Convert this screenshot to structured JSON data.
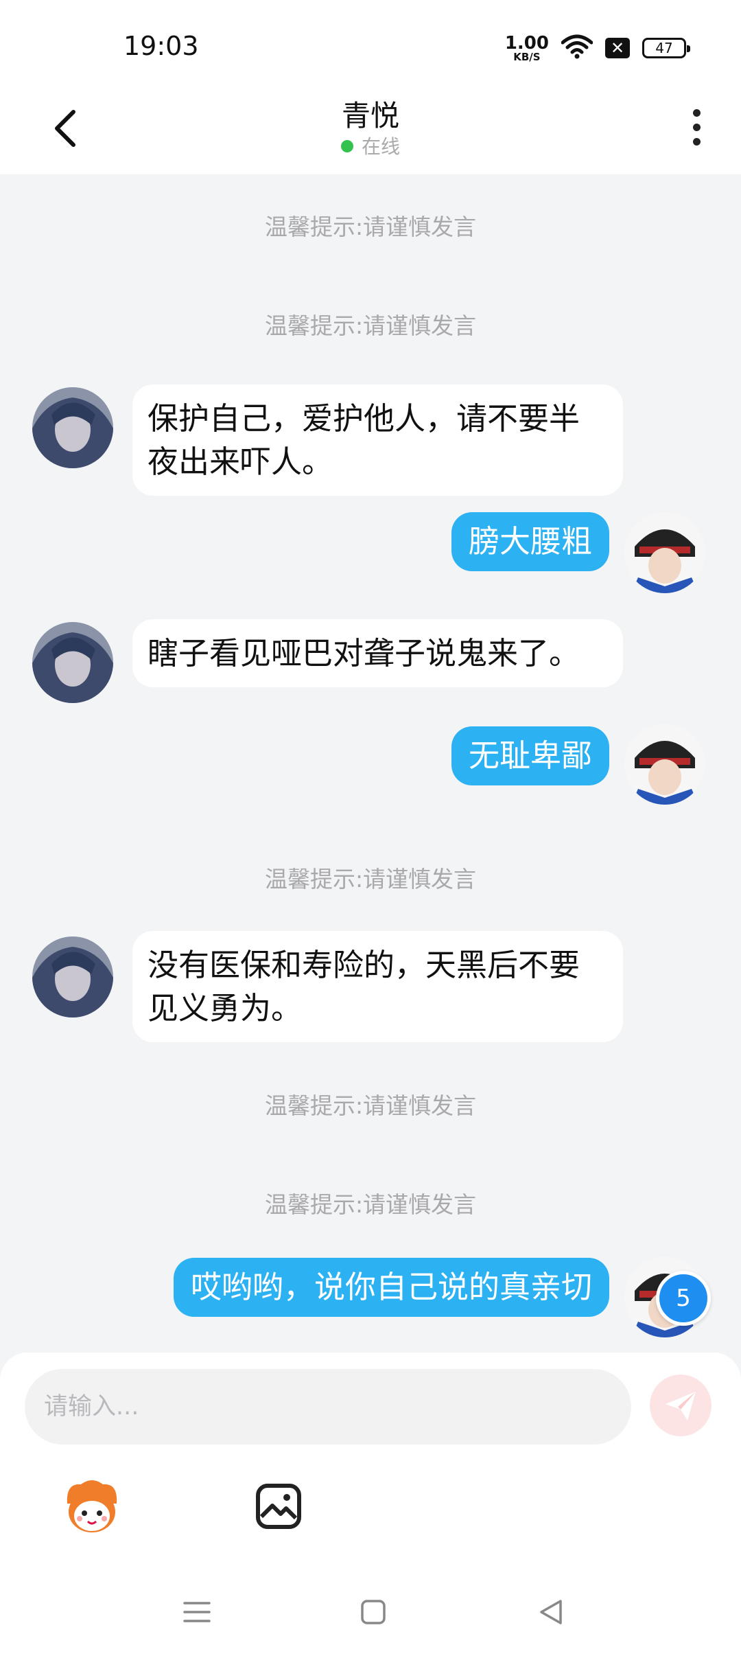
{
  "status_bar": {
    "time": "19:03",
    "net_speed_value": "1.00",
    "net_speed_unit": "KB/S",
    "battery": "47",
    "icons": [
      "wifi-icon",
      "close-badge-icon",
      "battery-icon"
    ]
  },
  "header": {
    "title": "青悦",
    "status": "在线",
    "status_color": "#33c24d"
  },
  "chat": {
    "hints": [
      "温馨提示:请谨慎发言",
      "温馨提示:请谨慎发言",
      "温馨提示:请谨慎发言",
      "温馨提示:请谨慎发言",
      "温馨提示:请谨慎发言"
    ],
    "messages": [
      {
        "side": "left",
        "text": "保护自己，爱护他人，请不要半夜出来吓人。"
      },
      {
        "side": "right",
        "text": "膀大腰粗"
      },
      {
        "side": "left",
        "text": "瞎子看见哑巴对聋子说鬼来了。"
      },
      {
        "side": "right",
        "text": "无耻卑鄙"
      },
      {
        "side": "left",
        "text": "没有医保和寿险的，天黑后不要见义勇为。"
      },
      {
        "side": "right",
        "text": "哎哟哟，说你自己说的真亲切"
      }
    ],
    "unread_count": "5",
    "accent_color": "#2cb1f2"
  },
  "input": {
    "placeholder": "请输入..."
  }
}
